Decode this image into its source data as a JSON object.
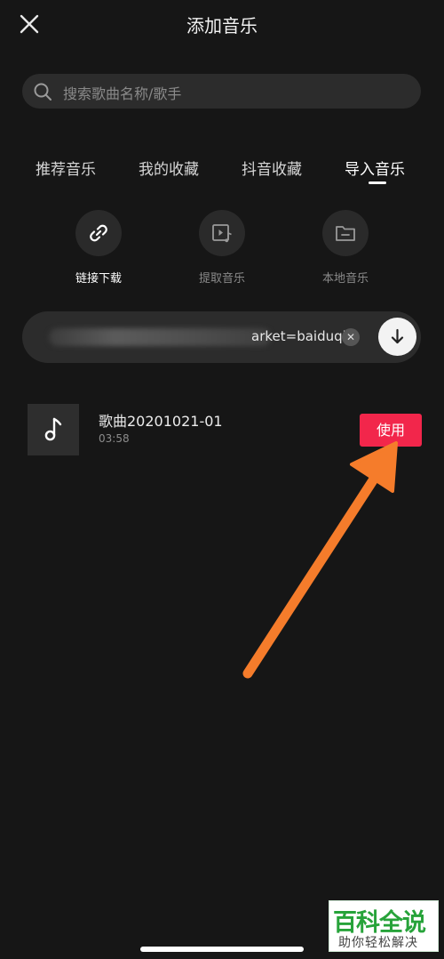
{
  "header": {
    "title": "添加音乐",
    "close_icon": "close-icon"
  },
  "search": {
    "placeholder": "搜索歌曲名称/歌手",
    "icon": "search-icon"
  },
  "tabs": [
    {
      "label": "推荐音乐",
      "active": false
    },
    {
      "label": "我的收藏",
      "active": false
    },
    {
      "label": "抖音收藏",
      "active": false
    },
    {
      "label": "导入音乐",
      "active": true
    }
  ],
  "import_options": [
    {
      "label": "链接下载",
      "icon": "link-icon",
      "active": true
    },
    {
      "label": "提取音乐",
      "icon": "video-music-icon",
      "active": false
    },
    {
      "label": "本地音乐",
      "icon": "folder-icon",
      "active": false
    }
  ],
  "url_input": {
    "value": "arket=baiduqk",
    "clear_icon": "clear-icon",
    "download_icon": "download-arrow-icon"
  },
  "song": {
    "title": "歌曲20201021-01",
    "duration": "03:58",
    "use_label": "使用",
    "cover_icon": "music-note-icon"
  },
  "colors": {
    "background": "#161616",
    "accent": "#f2264b",
    "annotation_arrow": "#f57c2b"
  },
  "watermark": {
    "title": "百科全说",
    "subtitle": "助你轻松解决"
  }
}
